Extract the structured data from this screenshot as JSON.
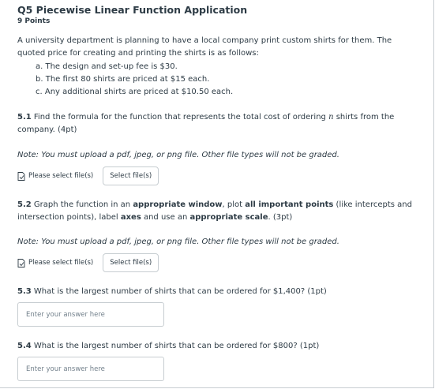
{
  "question": {
    "title": "Q5 Piecewise Linear Function Application",
    "points": "9 Points",
    "intro_line1": "A university department is planning to have a local company print custom shirts for them. The",
    "intro_line2": "quoted price for creating and printing the shirts is as follows:",
    "items": [
      "a. The design and set-up fee is $30.",
      "b. The first 80 shirts are priced at $15 each.",
      "c. Any additional shirts are priced at $10.50 each."
    ]
  },
  "part51": {
    "number": "5.1",
    "text_a": " Find the formula for the function that represents the total cost of ordering ",
    "var": "n",
    "text_b": " shirts from the",
    "line2": "company. (4pt)",
    "note": "Note: You must upload a pdf, jpeg, or png file. Other file types will not be graded.",
    "upload_label": "Please select file(s)",
    "button_label": "Select file(s)"
  },
  "part52": {
    "number": "5.2",
    "t1": " Graph the function in an ",
    "b1": "appropriate window",
    "t2": ", plot ",
    "b2": "all important points",
    "t3": " (like intercepts and",
    "t4": "intersection points), label ",
    "b3": "axes",
    "t5": " and use an ",
    "b4": "appropriate scale",
    "t6": ". (3pt)",
    "note": "Note: You must upload a pdf, jpeg, or png file. Other file types will not be graded.",
    "upload_label": "Please select file(s)",
    "button_label": "Select file(s)"
  },
  "part53": {
    "number": "5.3",
    "text": " What is the largest number of shirts that can be ordered for $1,400? (1pt)",
    "placeholder": "Enter your answer here"
  },
  "part54": {
    "number": "5.4",
    "text": " What is the largest number of shirts that can be ordered for $800? (1pt)",
    "placeholder": "Enter your answer here"
  },
  "icons": {
    "file": "file-icon"
  }
}
